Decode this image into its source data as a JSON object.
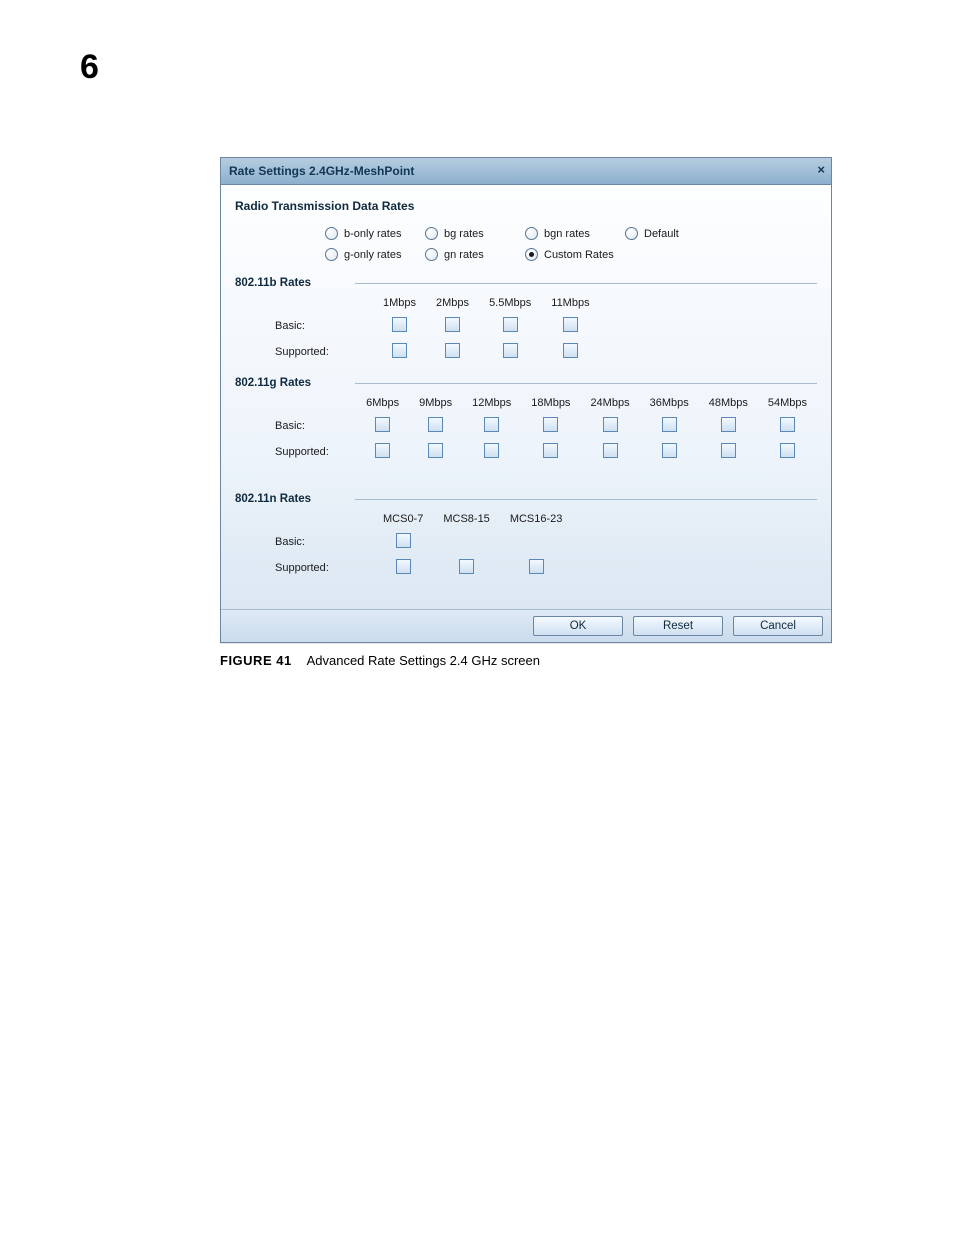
{
  "page": {
    "number": "6"
  },
  "dialog": {
    "title": "Rate Settings 2.4GHz-MeshPoint",
    "close_glyph": "×",
    "section_title": "Radio Transmission Data Rates",
    "radio_options": {
      "row1": [
        {
          "label": "b-only rates",
          "selected": false
        },
        {
          "label": "bg rates",
          "selected": false
        },
        {
          "label": "bgn rates",
          "selected": false
        },
        {
          "label": "Default",
          "selected": false
        }
      ],
      "row2": [
        {
          "label": "g-only rates",
          "selected": false
        },
        {
          "label": "gn rates",
          "selected": false
        },
        {
          "label": "Custom Rates",
          "selected": true
        }
      ]
    },
    "sections": {
      "b": {
        "legend": "802.11b Rates",
        "cols": [
          "1Mbps",
          "2Mbps",
          "5.5Mbps",
          "11Mbps"
        ],
        "rows": [
          "Basic:",
          "Supported:"
        ]
      },
      "g": {
        "legend": "802.11g Rates",
        "cols": [
          "6Mbps",
          "9Mbps",
          "12Mbps",
          "18Mbps",
          "24Mbps",
          "36Mbps",
          "48Mbps",
          "54Mbps"
        ],
        "rows": [
          "Basic:",
          "Supported:"
        ]
      },
      "n": {
        "legend": "802.11n Rates",
        "cols": [
          "MCS0-7",
          "MCS8-15",
          "MCS16-23"
        ],
        "rows": [
          "Basic:",
          "Supported:"
        ],
        "basic_count": 1,
        "supported_count": 3
      }
    },
    "buttons": {
      "ok": "OK",
      "reset": "Reset",
      "cancel": "Cancel"
    }
  },
  "caption": {
    "label": "FIGURE 41",
    "text": "Advanced Rate Settings 2.4 GHz screen"
  }
}
